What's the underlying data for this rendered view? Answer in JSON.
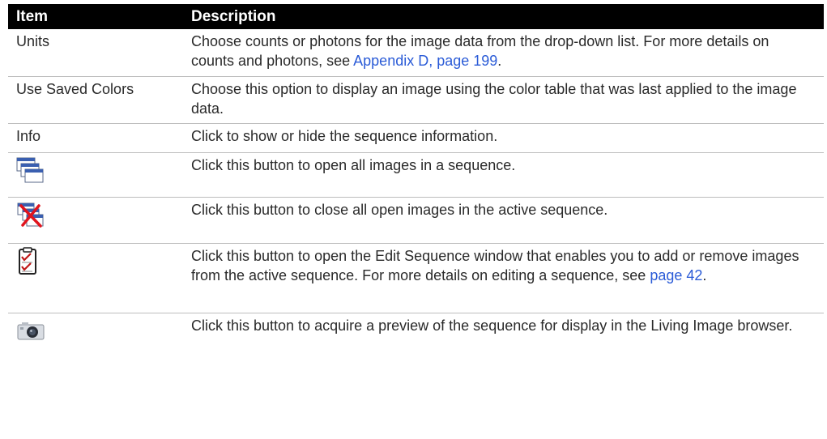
{
  "table": {
    "headers": {
      "item": "Item",
      "description": "Description"
    },
    "rows": [
      {
        "item": "Units",
        "description_before": "Choose counts or photons for the image data from the drop-down list. For more details on counts and photons, see ",
        "link": "Appendix D, page 199",
        "description_after": "."
      },
      {
        "item": "Use Saved Colors",
        "description": "Choose this option to display an image using the color table that was last applied to the image data."
      },
      {
        "item": "Info",
        "description": "Click to show or hide the sequence information."
      },
      {
        "icon": "open-all-windows-icon",
        "description": "Click this button to open all images in a sequence."
      },
      {
        "icon": "close-all-windows-icon",
        "description": "Click this button to close all open images in the active sequence."
      },
      {
        "icon": "edit-sequence-clipboard-icon",
        "description_before": "Click this button to open the Edit Sequence window that enables you to add or remove images from the active sequence. For more details on editing a sequence, see ",
        "link": "page 42",
        "description_after": "."
      },
      {
        "icon": "camera-preview-icon",
        "description": "Click this button to acquire a preview of the sequence for display in the Living Image browser."
      }
    ]
  },
  "colors": {
    "header_bg": "#000000",
    "header_text": "#ffffff",
    "link": "#2a5bd7",
    "row_divider": "#bdbdbd"
  }
}
